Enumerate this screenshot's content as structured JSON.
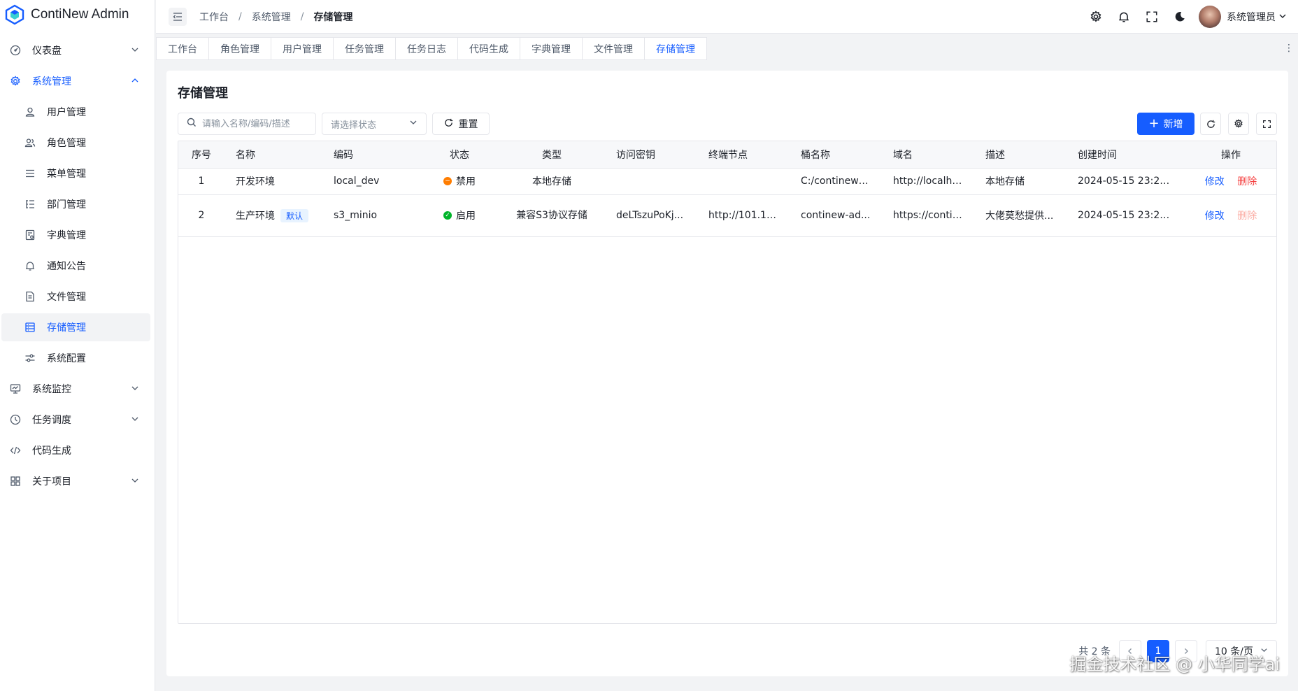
{
  "app": {
    "name": "ContiNew Admin"
  },
  "sidebar": {
    "items": [
      {
        "label": "仪表盘",
        "icon": "dashboard-icon",
        "has_arrow": true
      },
      {
        "label": "系统管理",
        "icon": "gear-icon",
        "has_arrow": true,
        "open": true,
        "children": [
          {
            "label": "用户管理",
            "icon": "user-icon"
          },
          {
            "label": "角色管理",
            "icon": "users-icon"
          },
          {
            "label": "菜单管理",
            "icon": "menu-icon"
          },
          {
            "label": "部门管理",
            "icon": "org-icon"
          },
          {
            "label": "字典管理",
            "icon": "dict-icon"
          },
          {
            "label": "通知公告",
            "icon": "bell-icon"
          },
          {
            "label": "文件管理",
            "icon": "file-icon"
          },
          {
            "label": "存储管理",
            "icon": "storage-icon",
            "active": true
          },
          {
            "label": "系统配置",
            "icon": "sliders-icon"
          }
        ]
      },
      {
        "label": "系统监控",
        "icon": "monitor-icon",
        "has_arrow": true
      },
      {
        "label": "任务调度",
        "icon": "clock-icon",
        "has_arrow": true
      },
      {
        "label": "代码生成",
        "icon": "code-icon",
        "has_arrow": false
      },
      {
        "label": "关于项目",
        "icon": "grid-icon",
        "has_arrow": true
      }
    ]
  },
  "header": {
    "breadcrumb": [
      "工作台",
      "系统管理",
      "存储管理"
    ],
    "user_name": "系统管理员"
  },
  "tabs": [
    "工作台",
    "角色管理",
    "用户管理",
    "任务管理",
    "任务日志",
    "代码生成",
    "字典管理",
    "文件管理",
    "存储管理"
  ],
  "active_tab": "存储管理",
  "page": {
    "title": "存储管理",
    "search_placeholder": "请输入名称/编码/描述",
    "status_placeholder": "请选择状态",
    "reset_label": "重置",
    "add_label": "新增"
  },
  "table": {
    "columns": [
      "序号",
      "名称",
      "编码",
      "状态",
      "类型",
      "访问密钥",
      "终端节点",
      "桶名称",
      "域名",
      "描述",
      "创建时间",
      "操作"
    ],
    "rows": [
      {
        "index": "1",
        "name": "开发环境",
        "is_default": false,
        "code": "local_dev",
        "status": "禁用",
        "status_color": "#ff7d00",
        "type": "本地存储",
        "access_key": "",
        "endpoint": "",
        "bucket": "C:/continew-...",
        "domain": "http://localho...",
        "description": "本地存储",
        "created": "2024-05-15 23:29:42",
        "edit": "修改",
        "delete": "删除",
        "delete_disabled": false
      },
      {
        "index": "2",
        "name": "生产环境",
        "is_default": true,
        "default_tag": "默认",
        "code": "s3_minio",
        "status": "启用",
        "status_color": "#00b42a",
        "type": "兼容S3协议存储",
        "access_key": "deLTszuPoKj...",
        "endpoint": "http://101.126...",
        "bucket": "continew-ad...",
        "domain": "https://contin...",
        "description": "大佬莫愁提供...",
        "created": "2024-05-15 23:29:42",
        "edit": "修改",
        "delete": "删除",
        "delete_disabled": true
      }
    ]
  },
  "pagination": {
    "total": "共 2 条",
    "current": "1",
    "page_size": "10 条/页"
  },
  "watermark": "掘金技术社区 @ 小华同学ai",
  "colors": {
    "primary": "#165dff",
    "danger": "#f53f3f"
  }
}
